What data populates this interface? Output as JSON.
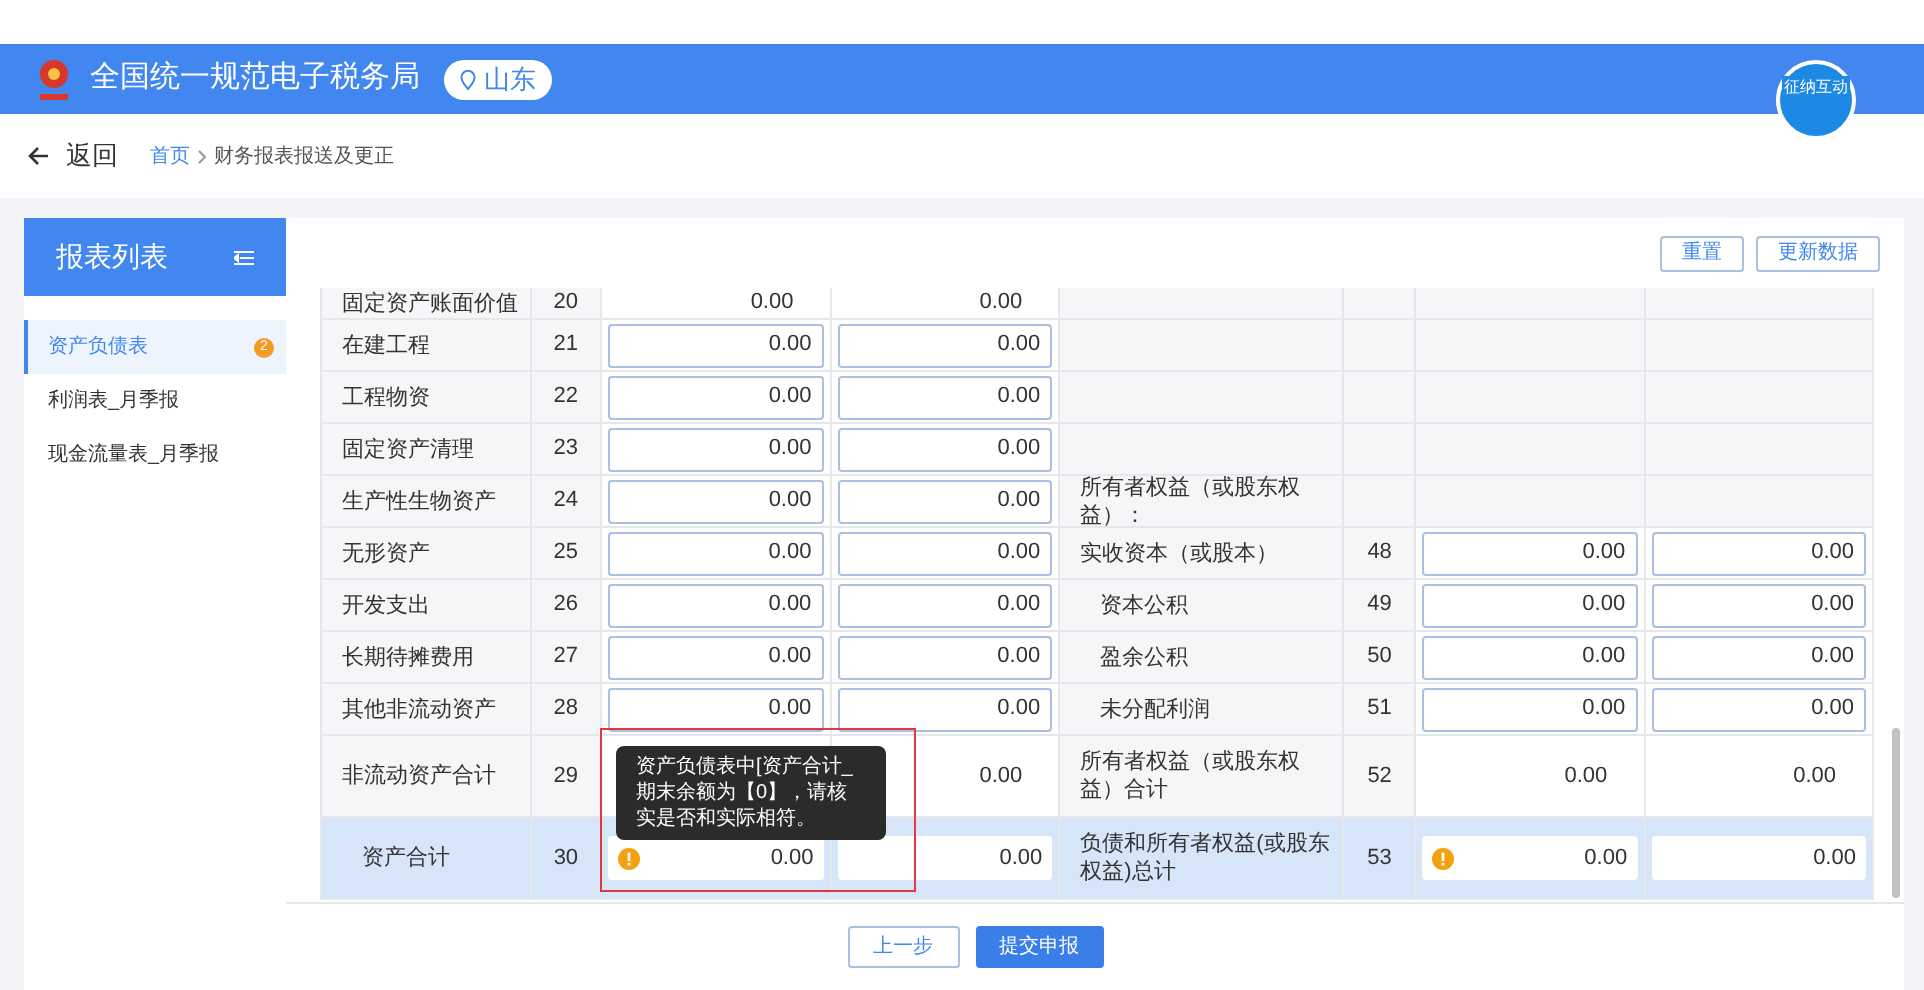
{
  "header": {
    "title": "全国统一规范电子税务局",
    "region": "山东",
    "assistant": "征纳互动"
  },
  "breadcrumb": {
    "back": "返回",
    "items": [
      "首页",
      "财务报表报送及更正"
    ]
  },
  "sidebar": {
    "title": "报表列表",
    "items": [
      {
        "label": "资产负债表",
        "selected": true,
        "badge": "2"
      },
      {
        "label": "利润表_月季报",
        "selected": false
      },
      {
        "label": "现金流量表_月季报",
        "selected": false
      }
    ]
  },
  "toolbar": [
    "重置",
    "更新数据"
  ],
  "table": {
    "rows": [
      {
        "partial": true,
        "highlighted": false,
        "left": {
          "label": "固定资产账面价值",
          "line": "20",
          "indented": false,
          "cells": [
            {
              "kind": "text",
              "value": "0.00",
              "warning": false
            },
            {
              "kind": "text",
              "value": "0.00",
              "warning": false
            }
          ]
        },
        "right": null
      },
      {
        "highlighted": false,
        "left": {
          "label": "在建工程",
          "line": "21",
          "indented": false,
          "cells": [
            {
              "kind": "input",
              "value": "0.00",
              "warning": false
            },
            {
              "kind": "input",
              "value": "0.00",
              "warning": false
            }
          ]
        },
        "right": null
      },
      {
        "highlighted": false,
        "left": {
          "label": "工程物资",
          "line": "22",
          "indented": false,
          "cells": [
            {
              "kind": "input",
              "value": "0.00",
              "warning": false
            },
            {
              "kind": "input",
              "value": "0.00",
              "warning": false
            }
          ]
        },
        "right": null
      },
      {
        "highlighted": false,
        "left": {
          "label": "固定资产清理",
          "line": "23",
          "indented": false,
          "cells": [
            {
              "kind": "input",
              "value": "0.00",
              "warning": false
            },
            {
              "kind": "input",
              "value": "0.00",
              "warning": false
            }
          ]
        },
        "right": null
      },
      {
        "highlighted": false,
        "left": {
          "label": "生产性生物资产",
          "line": "24",
          "indented": false,
          "cells": [
            {
              "kind": "input",
              "value": "0.00",
              "warning": false
            },
            {
              "kind": "input",
              "value": "0.00",
              "warning": false
            }
          ]
        },
        "right": {
          "label": "所有者权益（或股东权益）：",
          "indented": false
        }
      },
      {
        "highlighted": false,
        "left": {
          "label": "无形资产",
          "line": "25",
          "indented": false,
          "cells": [
            {
              "kind": "input",
              "value": "0.00",
              "warning": false
            },
            {
              "kind": "input",
              "value": "0.00",
              "warning": false
            }
          ]
        },
        "right": {
          "label": "实收资本（或股本）",
          "line": "48",
          "indented": false,
          "cells": [
            {
              "kind": "input",
              "value": "0.00",
              "warning": false
            },
            {
              "kind": "input",
              "value": "0.00",
              "warning": false
            }
          ]
        }
      },
      {
        "highlighted": false,
        "left": {
          "label": "开发支出",
          "line": "26",
          "indented": false,
          "cells": [
            {
              "kind": "input",
              "value": "0.00",
              "warning": false
            },
            {
              "kind": "input",
              "value": "0.00",
              "warning": false
            }
          ]
        },
        "right": {
          "label": "资本公积",
          "line": "49",
          "indented": true,
          "cells": [
            {
              "kind": "input",
              "value": "0.00",
              "warning": false
            },
            {
              "kind": "input",
              "value": "0.00",
              "warning": false
            }
          ]
        }
      },
      {
        "highlighted": false,
        "left": {
          "label": "长期待摊费用",
          "line": "27",
          "indented": false,
          "cells": [
            {
              "kind": "input",
              "value": "0.00",
              "warning": false
            },
            {
              "kind": "input",
              "value": "0.00",
              "warning": false
            }
          ]
        },
        "right": {
          "label": "盈余公积",
          "line": "50",
          "indented": true,
          "cells": [
            {
              "kind": "input",
              "value": "0.00",
              "warning": false
            },
            {
              "kind": "input",
              "value": "0.00",
              "warning": false
            }
          ]
        }
      },
      {
        "highlighted": false,
        "left": {
          "label": "其他非流动资产",
          "line": "28",
          "indented": false,
          "cells": [
            {
              "kind": "input",
              "value": "0.00",
              "warning": false
            },
            {
              "kind": "input",
              "value": "0.00",
              "warning": false
            }
          ]
        },
        "right": {
          "label": "未分配利润",
          "line": "51",
          "indented": true,
          "cells": [
            {
              "kind": "input",
              "value": "0.00",
              "warning": false
            },
            {
              "kind": "input",
              "value": "0.00",
              "warning": false
            }
          ]
        }
      },
      {
        "highlighted": false,
        "tall": true,
        "left": {
          "label": "非流动资产合计",
          "line": "29",
          "indented": false,
          "cells": [
            {
              "kind": "covered"
            },
            {
              "kind": "text",
              "value": "0.00",
              "warning": false
            }
          ]
        },
        "right": {
          "label": "所有者权益（或股东权益）合计",
          "line": "52",
          "indented": false,
          "cells": [
            {
              "kind": "text",
              "value": "0.00",
              "warning": false
            },
            {
              "kind": "text",
              "value": "0.00",
              "warning": false
            }
          ]
        }
      },
      {
        "highlighted": true,
        "tall": true,
        "left": {
          "label": "资产合计",
          "line": "30",
          "indented": true,
          "cells": [
            {
              "kind": "input",
              "value": "0.00",
              "warning": true
            },
            {
              "kind": "input",
              "value": "0.00",
              "warning": false
            }
          ]
        },
        "right": {
          "label": "负债和所有者权益(或股东权益)总计",
          "line": "53",
          "indented": false,
          "cells": [
            {
              "kind": "input",
              "value": "0.00",
              "warning": true
            },
            {
              "kind": "input",
              "value": "0.00",
              "warning": false
            }
          ]
        }
      }
    ]
  },
  "tooltip": {
    "text": "资产负债表中[资产合计_期末余额为【0】，请核实是否和实际相符。"
  },
  "footer": {
    "buttons": [
      {
        "label": "上一步",
        "kind": "secondary"
      },
      {
        "label": "提交申报",
        "kind": "primary"
      }
    ]
  }
}
